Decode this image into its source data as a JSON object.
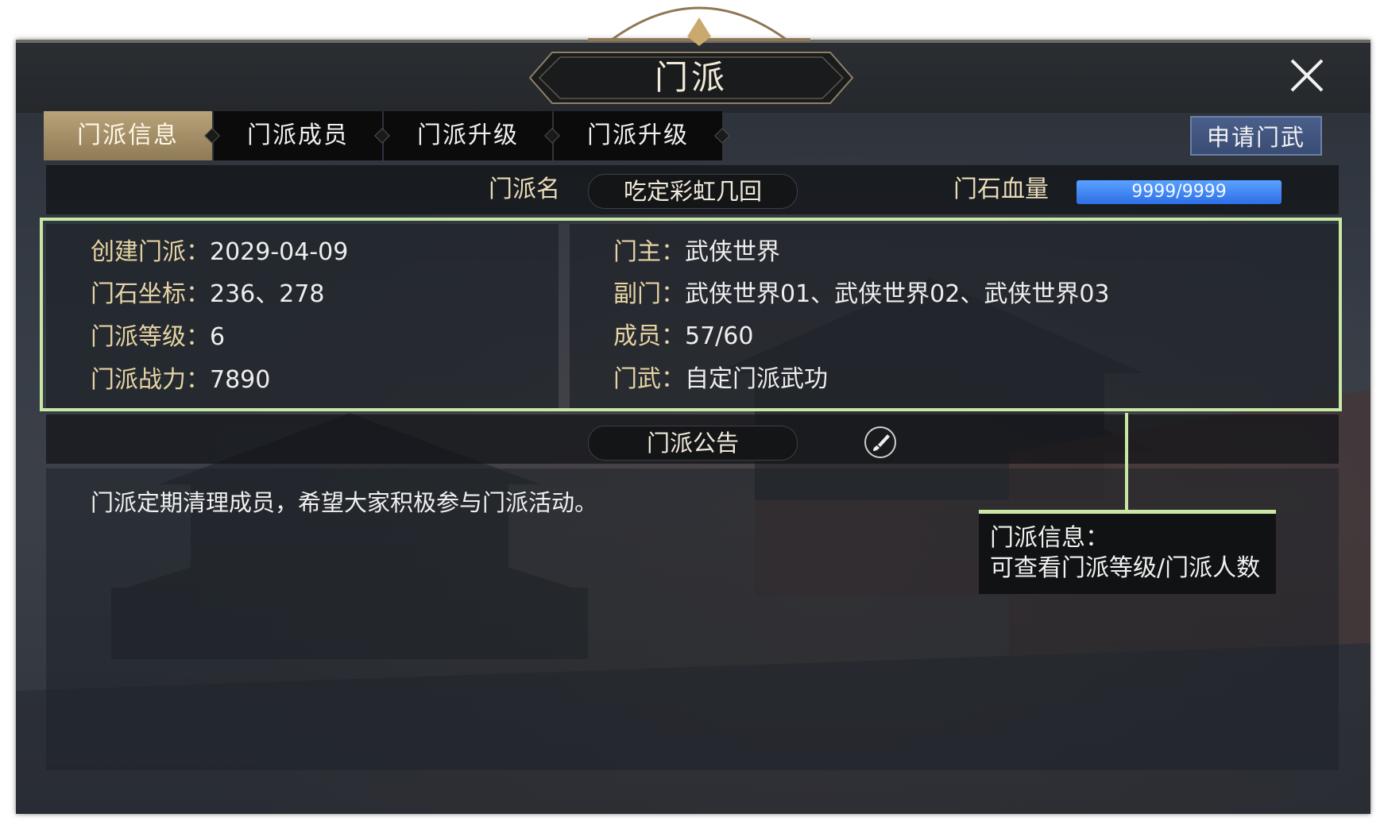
{
  "window": {
    "title": "门派",
    "close_icon": "close-icon"
  },
  "tabs": [
    {
      "label": "门派信息",
      "active": true
    },
    {
      "label": "门派成员",
      "active": false
    },
    {
      "label": "门派升级",
      "active": false
    },
    {
      "label": "门派升级",
      "active": false
    }
  ],
  "apply_button": "申请门武",
  "name_row": {
    "label": "门派名",
    "value": "吃定彩虹几回",
    "hp_label": "门石血量",
    "hp_value": "9999/9999"
  },
  "info": {
    "left": [
      {
        "key": "创建门派：",
        "value": "2029-04-09"
      },
      {
        "key": "门石坐标：",
        "value": "236、278"
      },
      {
        "key": "门派等级：",
        "value": "6"
      },
      {
        "key": "门派战力：",
        "value": "7890"
      }
    ],
    "right": [
      {
        "key": "门主：",
        "value": "武侠世界"
      },
      {
        "key": "副门：",
        "value": "武侠世界01、武侠世界02、武侠世界03"
      },
      {
        "key": "成员：",
        "value": "57/60"
      },
      {
        "key": "门武：",
        "value": "自定门派武功"
      }
    ]
  },
  "notice": {
    "label": "门派公告",
    "edit_icon": "brush-icon",
    "text": "门派定期清理成员，希望大家积极参与门派活动。"
  },
  "callout": {
    "line1": "门派信息：",
    "line2": "可查看门派等级/门派人数"
  },
  "colors": {
    "highlight": "#c8e8a4",
    "active_tab": "#b9a37a",
    "hp_bar": "#3f86f0",
    "apply_button": "#40537c"
  }
}
